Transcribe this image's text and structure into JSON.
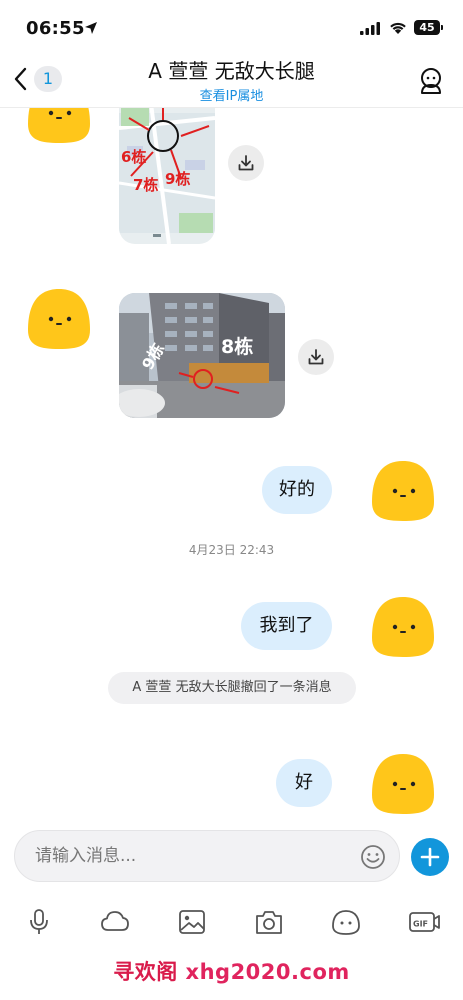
{
  "status_bar": {
    "time": "06:55",
    "battery": "45"
  },
  "header": {
    "back_badge": "1",
    "title": "A  萱萱 无敌大长腿",
    "subtitle": "查看IP属地"
  },
  "messages": [
    {
      "type": "image",
      "side": "left",
      "content": "map screenshot with building labels",
      "labels": [
        "6栋",
        "7栋",
        "9栋"
      ]
    },
    {
      "type": "image",
      "side": "left",
      "content": "street photo with building labels",
      "labels": [
        "9栋",
        "8栋"
      ]
    },
    {
      "type": "text",
      "side": "right",
      "text": "好的"
    },
    {
      "type": "timestamp",
      "text": "4月23日 22:43"
    },
    {
      "type": "text",
      "side": "right",
      "text": "我到了"
    },
    {
      "type": "system",
      "text": "A  萱萱 无敌大长腿撤回了一条消息"
    },
    {
      "type": "text",
      "side": "right",
      "text": "好"
    }
  ],
  "input": {
    "placeholder": "请输入消息..."
  },
  "toolbar": {
    "items": [
      "mic-icon",
      "cloud-icon",
      "image-icon",
      "camera-icon",
      "sticker-icon",
      "gif-icon"
    ]
  },
  "watermark": {
    "text_a": "寻欢阁",
    "text_b": "xhg2020.com"
  },
  "colors": {
    "accent": "#1296db",
    "bubble": "#dbeefd",
    "avatar": "#ffc61a"
  }
}
